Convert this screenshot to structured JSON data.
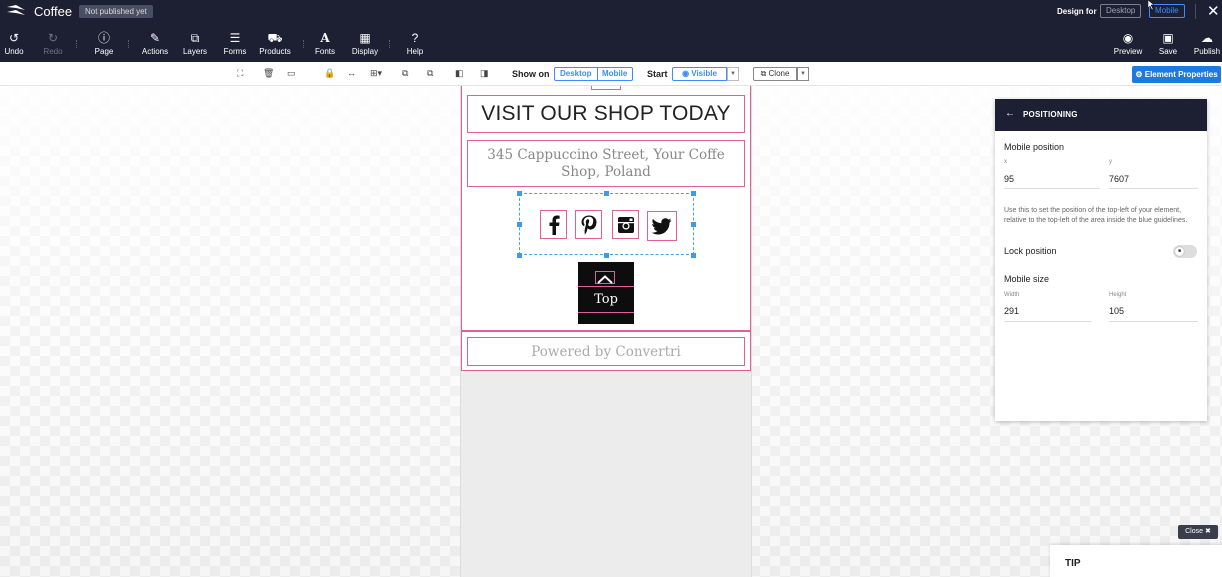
{
  "app": {
    "title": "Coffee",
    "status_badge": "Not published yet",
    "design_for_label": "Design for",
    "design_for_desktop": "Desktop",
    "design_for_mobile": "Mobile",
    "close_symbol": "✕"
  },
  "toolbar": {
    "undo": "Undo",
    "redo": "Redo",
    "page": "Page",
    "actions": "Actions",
    "layers": "Layers",
    "forms": "Forms",
    "products": "Products",
    "fonts": "Fonts",
    "display": "Display",
    "help": "Help",
    "preview": "Preview",
    "save": "Save",
    "publish": "Publish"
  },
  "element_bar": {
    "show_on_label": "Show on",
    "show_desktop": "Desktop",
    "show_mobile": "Mobile",
    "start_label": "Start",
    "visible": "Visible",
    "clone": "Clone",
    "element_properties": "Element Properties"
  },
  "canvas": {
    "heading": "VISIT OUR SHOP TODAY",
    "address": "345 Cappuccino Street, Your Coffe Shop, Poland",
    "top_button": "Top",
    "powered_by": "Powered by Convertri",
    "social_icons": [
      "facebook-icon",
      "pinterest-icon",
      "instagram-icon",
      "twitter-icon"
    ]
  },
  "panel": {
    "title": "POSITIONING",
    "mobile_position_label": "Mobile position",
    "x_label": "x",
    "y_label": "y",
    "x_value": "95",
    "y_value": "7607",
    "help_text": "Use this to set the position of the top-left of your element, relative to the top-left of the area inside the blue guidelines.",
    "lock_label": "Lock position",
    "mobile_size_label": "Mobile size",
    "width_label": "Width",
    "height_label": "Height",
    "width_value": "291",
    "height_value": "105"
  },
  "tip": {
    "close_label": "Close",
    "title": "TIP"
  },
  "colors": {
    "topbar": "#1d2033",
    "accent": "#1f7ae0",
    "guide": "#e0609c",
    "selection": "#4aa3e0"
  }
}
